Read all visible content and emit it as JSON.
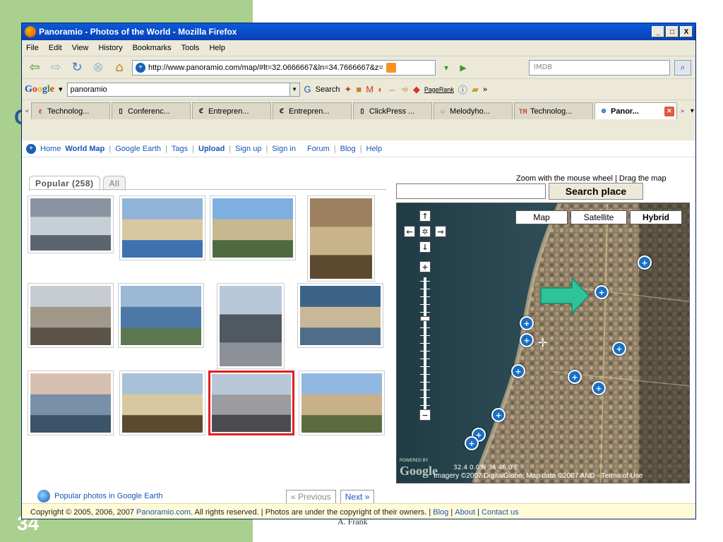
{
  "slide": {
    "number": "34",
    "footer": "A. Frank",
    "letter": "C"
  },
  "window": {
    "title": "Panoramio - Photos of the World - Mozilla Firefox",
    "buttons": [
      "_",
      "□",
      "X"
    ]
  },
  "menu": [
    "File",
    "Edit",
    "View",
    "History",
    "Bookmarks",
    "Tools",
    "Help"
  ],
  "nav": {
    "url": "http://www.panoramio.com/map/#lt=32.0666667&ln=34.7666667&z=",
    "search_value": "IMDB"
  },
  "google_toolbar": {
    "logo": "Google",
    "query": "panoramio",
    "search_label": "Search",
    "pagerank": "PageRank"
  },
  "tabs": [
    {
      "label": "Technolog...",
      "icon": "technolog-icon"
    },
    {
      "label": "Conferenc...",
      "icon": "page-icon"
    },
    {
      "label": "Entrepren...",
      "icon": "entrepreneur-icon"
    },
    {
      "label": "Entrepren...",
      "icon": "entrepreneur-icon"
    },
    {
      "label": "ClickPress ...",
      "icon": "page-icon"
    },
    {
      "label": "Melodyho...",
      "icon": "melody-icon"
    },
    {
      "label": "Technolog...",
      "icon": "tr-icon"
    },
    {
      "label": "Panor...",
      "icon": "panoramio-icon",
      "active": true
    }
  ],
  "sitenav": {
    "home": "Home",
    "world_map": "World Map",
    "google_earth": "Google Earth",
    "tags": "Tags",
    "upload": "Upload",
    "signup": "Sign up",
    "signin": "Sign in",
    "forum": "Forum",
    "blog": "Blog",
    "help": "Help"
  },
  "photo_tabs": {
    "popular": "Popular (258)",
    "all": "All"
  },
  "thumbs": [
    {
      "name": "city-aerial",
      "colors": [
        "#8a94a0",
        "#c7cfd6",
        "#5c6470"
      ]
    },
    {
      "name": "beach-umbrellas",
      "colors": [
        "#8fb4d8",
        "#d8c8a0",
        "#3f70b0"
      ]
    },
    {
      "name": "palm-building",
      "colors": [
        "#7db0e0",
        "#c8b890",
        "#4f6a40"
      ]
    },
    {
      "name": "doorway",
      "colors": [
        "#9c8060",
        "#c8b488",
        "#5c4a30"
      ]
    },
    {
      "name": "beach-kiosk",
      "colors": [
        "#c6ccd2",
        "#a09888",
        "#5c5448"
      ]
    },
    {
      "name": "coast-skyline",
      "colors": [
        "#9cb8d4",
        "#4c78a8",
        "#5c7850"
      ]
    },
    {
      "name": "towers",
      "colors": [
        "#b8c8d8",
        "#505860",
        "#8c9098"
      ]
    },
    {
      "name": "coast-aerial",
      "colors": [
        "#3c6488",
        "#c8b898",
        "#4f6c88"
      ]
    },
    {
      "name": "sunset-sea",
      "colors": [
        "#d8c0b0",
        "#7890a8",
        "#3c5468"
      ]
    },
    {
      "name": "bauhaus-building",
      "colors": [
        "#a8c0d8",
        "#d8c8a0",
        "#5c4a30"
      ]
    },
    {
      "name": "long-building",
      "colors": [
        "#b8c8d8",
        "#9c9ca0",
        "#4c4c50"
      ]
    },
    {
      "name": "plaza-trees",
      "colors": [
        "#90b8e0",
        "#c8b088",
        "#5c6c40"
      ]
    }
  ],
  "bottom": {
    "google_earth_link": "Popular photos in Google Earth",
    "previous": "« Previous",
    "next": "Next »"
  },
  "map": {
    "hint": "Zoom with the mouse wheel | Drag the map",
    "search_button": "Search place",
    "types": [
      "Map",
      "Satellite",
      "Hybrid"
    ],
    "active_type": "Hybrid",
    "powered": "POWERED BY",
    "google": "Google",
    "copyright": "Imagery ©2007 DigitalGlobe, Map data ©2007 AND - Terms of Use",
    "scale": "32.4 0.0'N 34 46.0'E"
  },
  "footer": {
    "copyright": "Copyright © 2005, 2006, 2007",
    "site": "Panoramio.com",
    "rights": ". All rights reserved. | Photos are under the copyright of their owners. |",
    "blog": "Blog",
    "about": "About",
    "contact": "Contact us"
  }
}
